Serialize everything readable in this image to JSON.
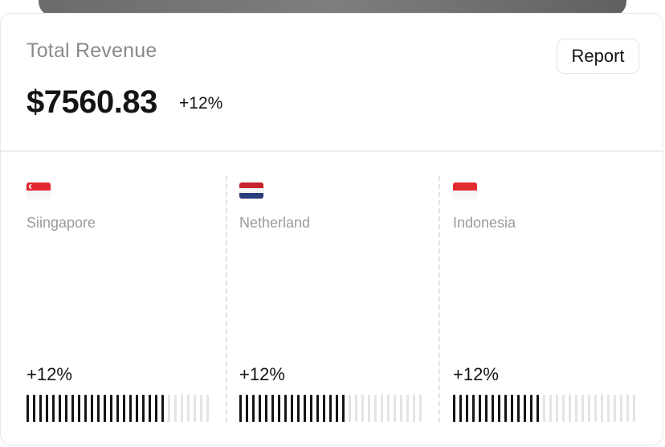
{
  "header": {
    "title": "Total Revenue",
    "amount": "$7560.83",
    "delta": "+12%",
    "report_label": "Report"
  },
  "countries": [
    {
      "name": "Siingapore",
      "flag_icon": "singapore-flag-icon",
      "delta": "+12%",
      "progress": 0.75
    },
    {
      "name": "Netherland",
      "flag_icon": "netherlands-flag-icon",
      "delta": "+12%",
      "progress": 0.57
    },
    {
      "name": "Indonesia",
      "flag_icon": "indonesia-flag-icon",
      "delta": "+12%",
      "progress": 0.47
    }
  ],
  "colors": {
    "text_primary": "#141414",
    "text_muted": "#8a8a8a",
    "bar_active": "#141414",
    "bar_inactive": "#e4e4e4",
    "border": "#e8e8e8"
  }
}
